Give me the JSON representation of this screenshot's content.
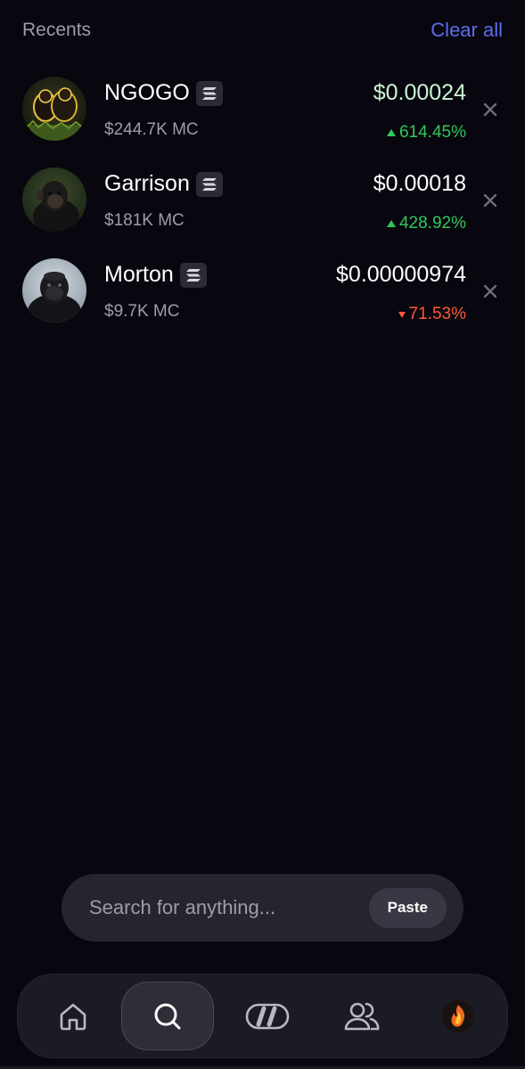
{
  "header": {
    "title": "Recents",
    "clear_all_label": "Clear all"
  },
  "recents": [
    {
      "name": "NGOGO",
      "chain_icon": "solana-icon",
      "market_cap": "$244.7K MC",
      "price": "$0.00024",
      "change": "614.45%",
      "direction": "up"
    },
    {
      "name": "Garrison",
      "chain_icon": "solana-icon",
      "market_cap": "$181K MC",
      "price": "$0.00018",
      "change": "428.92%",
      "direction": "up"
    },
    {
      "name": "Morton",
      "chain_icon": "solana-icon",
      "market_cap": "$9.7K MC",
      "price": "$0.00000974",
      "change": "71.53%",
      "direction": "down"
    }
  ],
  "search": {
    "placeholder": "Search for anything...",
    "paste_label": "Paste"
  },
  "nav": {
    "items": [
      "home-icon",
      "search-icon",
      "trade-icon",
      "people-icon",
      "profile-avatar"
    ],
    "active": "search-icon"
  },
  "colors": {
    "background": "#08070f",
    "accent": "#5b6df0",
    "positive": "#2ec95c",
    "negative": "#ff5a36",
    "muted_text": "#9d9ca8"
  }
}
